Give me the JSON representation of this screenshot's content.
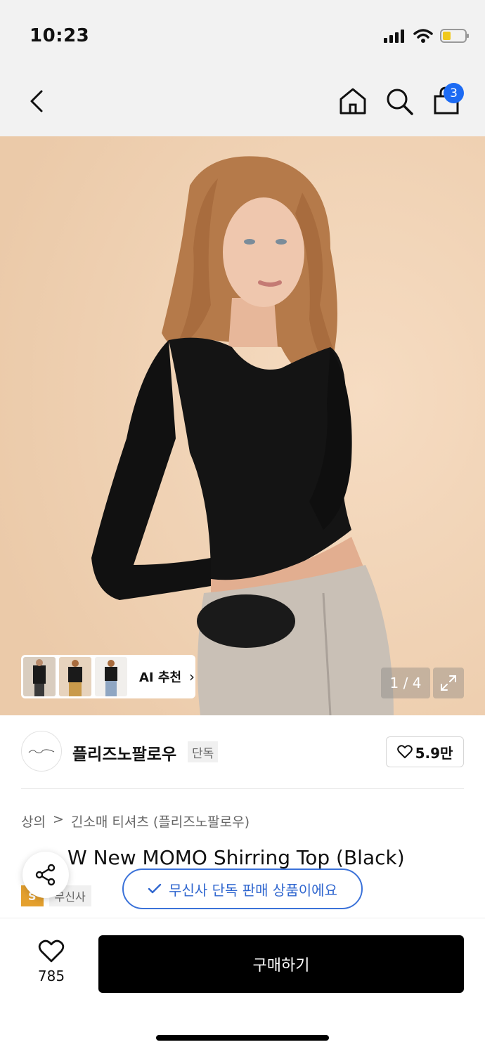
{
  "status": {
    "time": "10:23"
  },
  "nav": {
    "cart_count": "3"
  },
  "gallery": {
    "ai_label": "AI 추천",
    "page_indicator": "1 / 4"
  },
  "brand": {
    "name": "플리즈노팔로우",
    "tag": "단독",
    "likes": "5.9만"
  },
  "breadcrumb": {
    "category": "상의",
    "separator": ">",
    "subcategory": "긴소매 티셔츠 (플리즈노팔로우)"
  },
  "product": {
    "title": "W New MOMO Shirring Top (Black)",
    "badge_sale": "S",
    "badge_store": "무신사"
  },
  "exclusive_notice": "무신사 단독 판매 상품이에요",
  "bottom": {
    "wish_count": "785",
    "buy_label": "구매하기"
  },
  "colors": {
    "accent": "#1d6bf3",
    "pill": "#3b72d9",
    "badge": "#e4a02e",
    "buy": "#000000"
  }
}
